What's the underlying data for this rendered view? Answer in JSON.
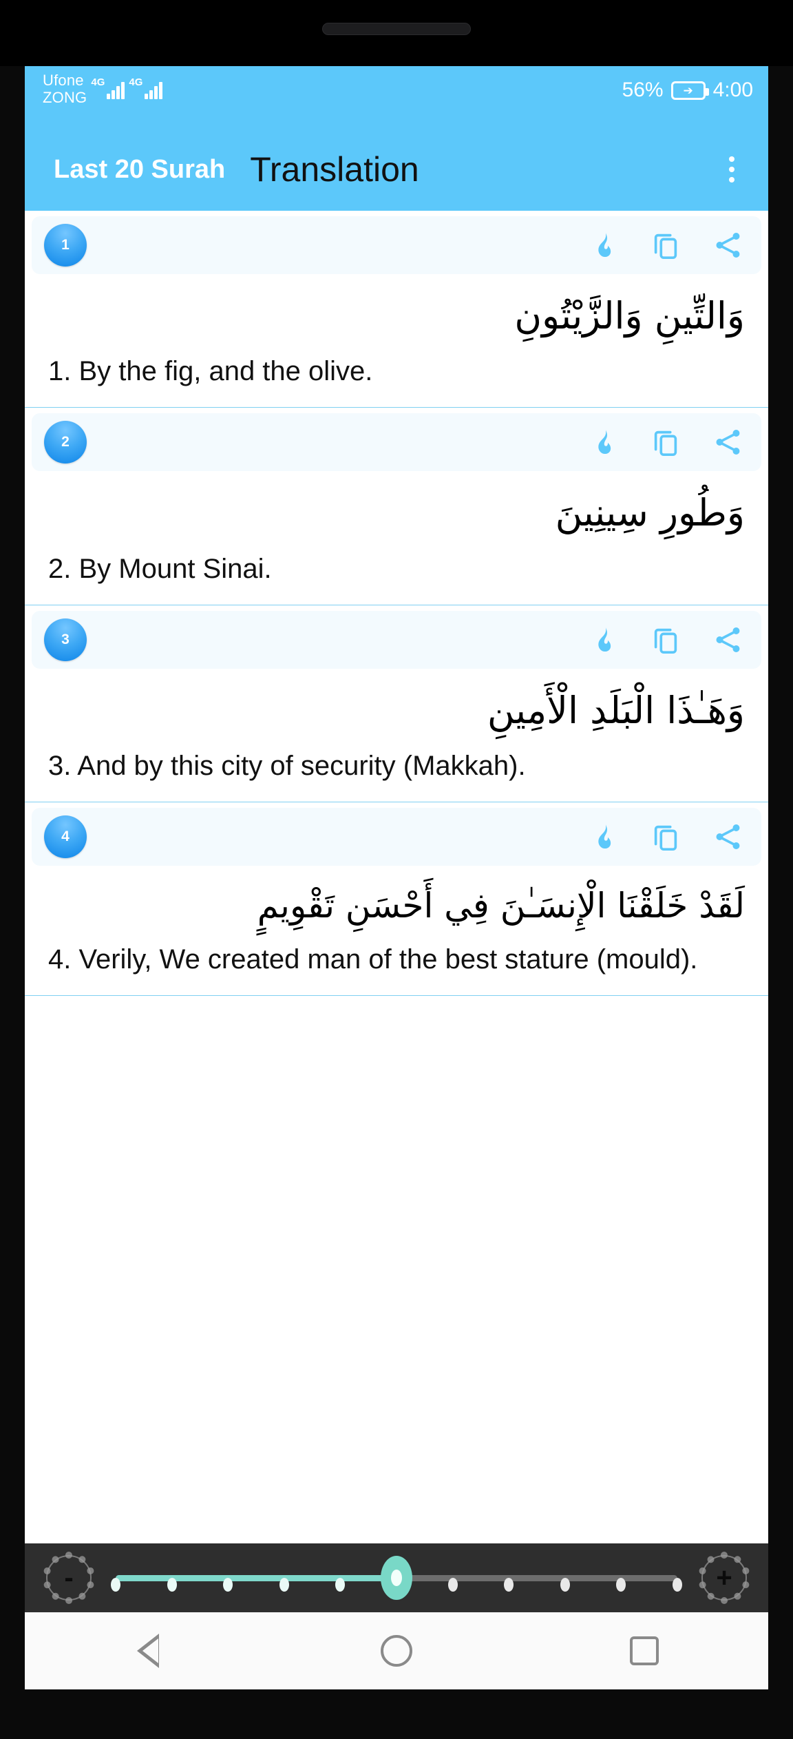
{
  "status_bar": {
    "carrier_line1": "Ufone",
    "carrier_line2": "ZONG",
    "network1": "4G",
    "network2": "4G",
    "battery_percent": "56%",
    "battery_state": "charging",
    "clock": "4:00",
    "background_color": "#5CC8FA"
  },
  "app_bar": {
    "subtitle": "Last 20 Surah",
    "title": "Translation",
    "overflow_menu": "more-options",
    "background_color": "#5CC8FA",
    "subtitle_color": "#ffffff",
    "title_color": "#111111"
  },
  "row_actions": {
    "play_label": "play",
    "copy_label": "copy",
    "share_label": "share",
    "icon_color": "#5CC8FA"
  },
  "verses": [
    {
      "number": "1",
      "arabic": "وَالتِّينِ وَالزَّيْتُونِ",
      "translation": "1. By the fig, and the olive."
    },
    {
      "number": "2",
      "arabic": "وَطُورِ سِينِينَ",
      "translation": "2. By Mount Sinai."
    },
    {
      "number": "3",
      "arabic": "وَهَـٰذَا الْبَلَدِ الْأَمِينِ",
      "translation": "3. And by this city of security (Makkah)."
    },
    {
      "number": "4",
      "arabic": "لَقَدْ خَلَقْنَا الْإِنسَـٰنَ فِي أَحْسَنِ تَقْوِيمٍ",
      "translation": "4. Verily, We created man of the best stature (mould)."
    }
  ],
  "seek_bar": {
    "decrease_label": "-",
    "increase_label": "+",
    "ticks": 11,
    "value_index": 5,
    "fill_color": "#7FD8CB",
    "track_color": "#6d6d6d",
    "background_color": "#2E2E2E"
  },
  "nav_bar": {
    "back": "back",
    "home": "home",
    "recents": "recents"
  }
}
